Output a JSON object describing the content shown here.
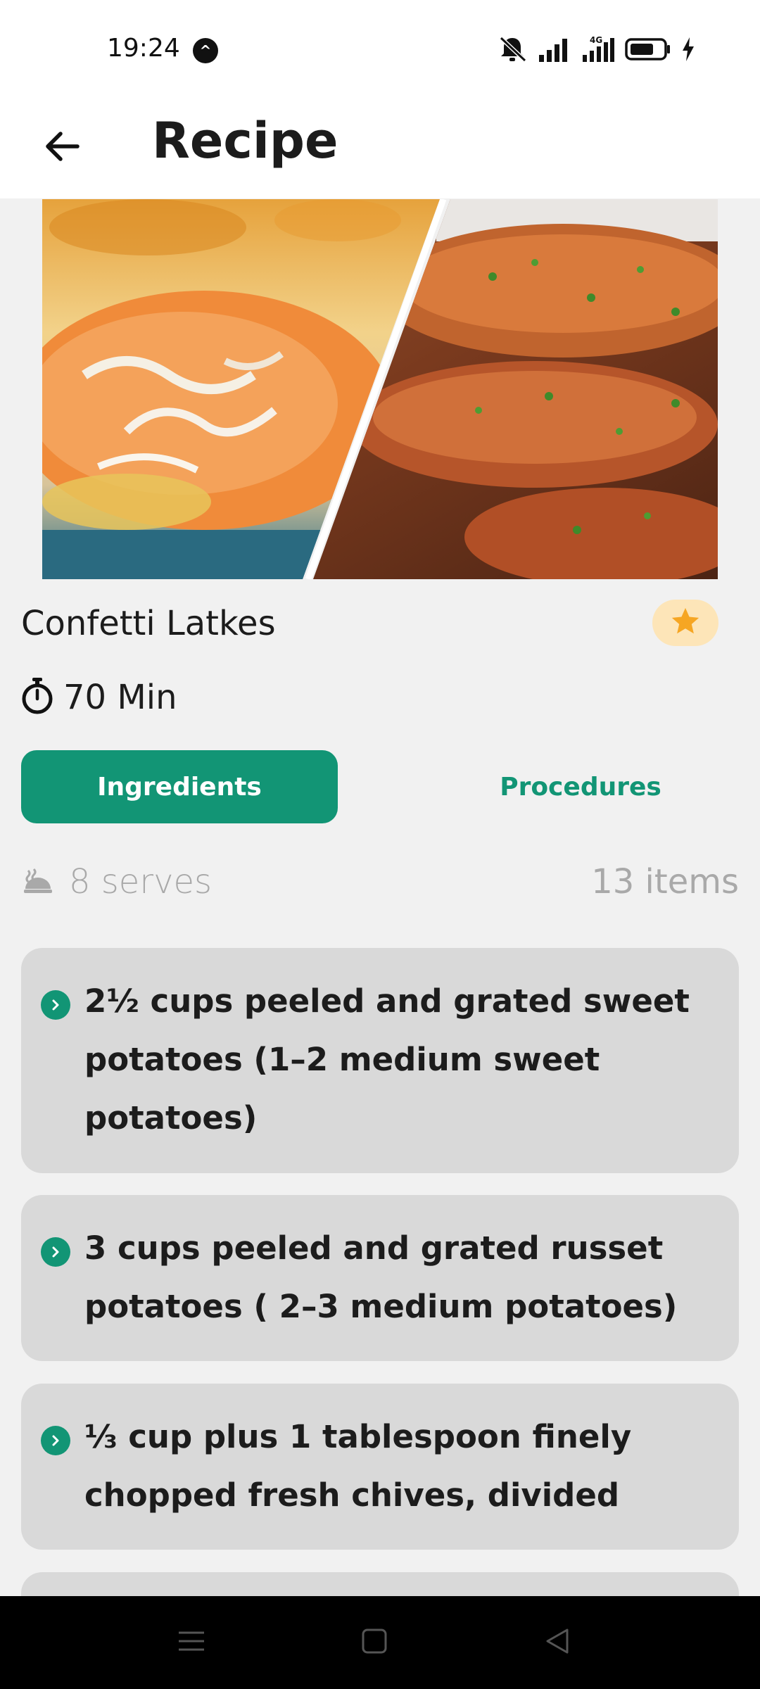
{
  "status_bar": {
    "time": "19:24",
    "network": "4G",
    "icons": [
      "notification-logo-icon",
      "mute-icon",
      "signal-icon",
      "signal-4g-icon",
      "battery-icon",
      "charging-icon"
    ]
  },
  "app_bar": {
    "title": "Recipe",
    "back_icon": "back-arrow-icon"
  },
  "recipe": {
    "title": "Confetti Latkes",
    "time": "70 Min",
    "favorite": true,
    "accent": "#129575",
    "favorite_bg": "#fde5b8",
    "favorite_color": "#f6a623"
  },
  "tabs": {
    "ingredients": "Ingredients",
    "procedures": "Procedures",
    "active": "ingredients"
  },
  "meta": {
    "serves": "8 serves",
    "items": "13 items"
  },
  "ingredients": [
    {
      "text": "2½ cups peeled and grated sweet potatoes (1–2 medium sweet potatoes)"
    },
    {
      "text": "3 cups peeled and grated russet potatoes ( 2–3 medium potatoes)"
    },
    {
      "text": "⅓ cup plus 1 tablespoon finely chopped fresh chives, divided"
    },
    {
      "text": ""
    }
  ],
  "nav_bar": {
    "icons": [
      "menu-icon",
      "home-square-icon",
      "back-triangle-icon"
    ]
  }
}
